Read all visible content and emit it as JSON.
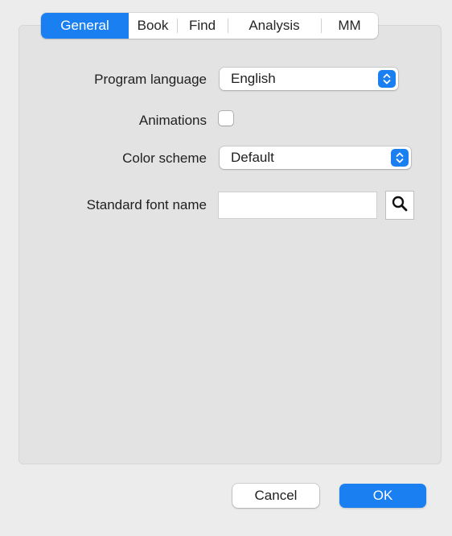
{
  "tabs": [
    {
      "label": "General",
      "active": true
    },
    {
      "label": "Book",
      "active": false
    },
    {
      "label": "Find",
      "active": false
    },
    {
      "label": "Analysis",
      "active": false
    },
    {
      "label": "MM",
      "active": false
    }
  ],
  "form": {
    "program_language": {
      "label": "Program language",
      "value": "English"
    },
    "animations": {
      "label": "Animations",
      "checked": false
    },
    "color_scheme": {
      "label": "Color scheme",
      "value": "Default"
    },
    "standard_font_name": {
      "label": "Standard font name",
      "value": "",
      "search_icon": "magnifier-icon"
    }
  },
  "buttons": {
    "cancel": "Cancel",
    "ok": "OK"
  },
  "colors": {
    "accent": "#1a7ff0",
    "window_bg": "#ececec",
    "panel_bg": "#e3e3e3"
  }
}
